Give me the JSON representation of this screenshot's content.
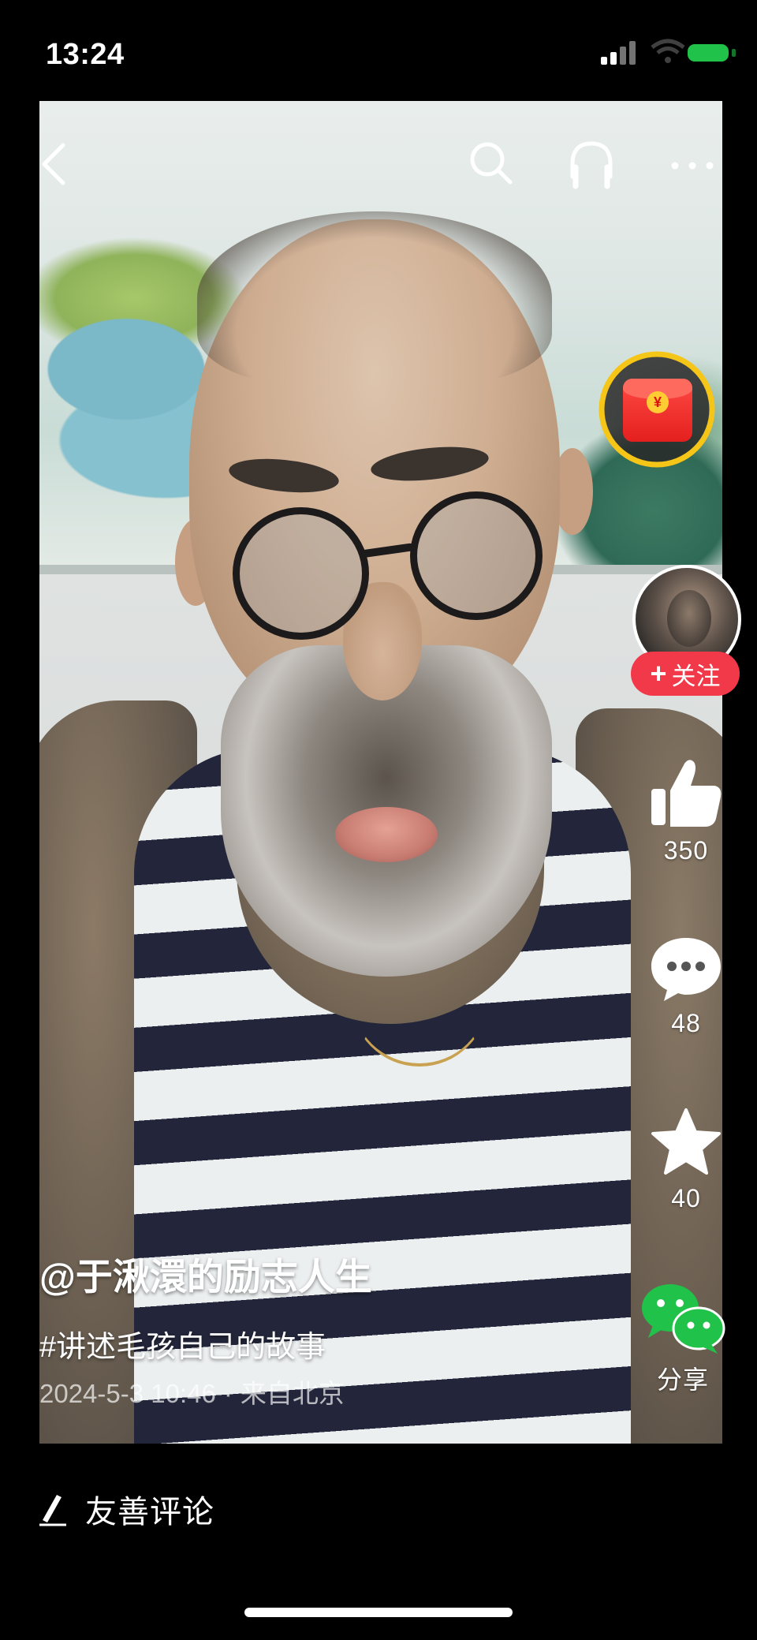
{
  "status_bar": {
    "time": "13:24"
  },
  "top_bar": {
    "back_icon": "chevron-left-icon",
    "search_icon": "search-icon",
    "listen_icon": "headphones-icon",
    "more_icon": "more-horizontal-icon"
  },
  "red_packet": {
    "icon": "red-envelope-icon",
    "coin_symbol": "¥",
    "ring_color": "#f5c518"
  },
  "author": {
    "follow_label": "关注",
    "follow_plus": "+",
    "follow_color": "#f2394a"
  },
  "actions": {
    "like_count": "350",
    "comment_count": "48",
    "favorite_count": "40",
    "share_label": "分享",
    "share_color": "#21c24a"
  },
  "caption": {
    "author_name": "@于湫澴的励志人生",
    "hashtag": "#讲述毛孩自己的故事",
    "date": "2024-5-3 10:46",
    "separator": "·",
    "location": "来自北京"
  },
  "comment_bar": {
    "placeholder": "友善评论",
    "icon": "pen-icon"
  }
}
